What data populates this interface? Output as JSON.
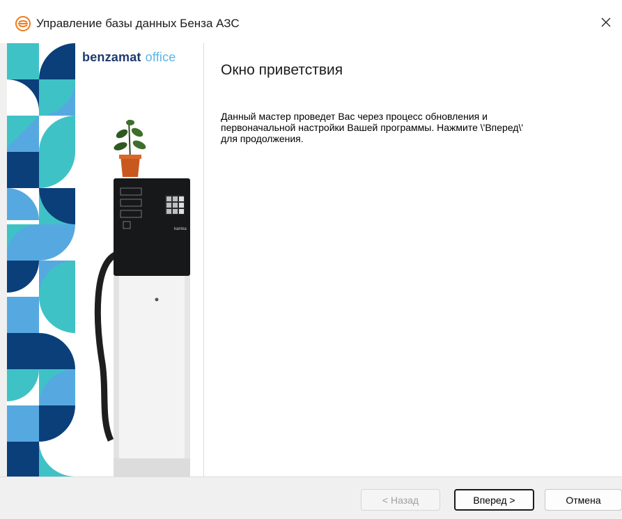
{
  "window": {
    "title": "Управление базы данных Бенза АЗС",
    "close_symbol": "✕"
  },
  "brand": {
    "part1": "benzamat",
    "part2": "office"
  },
  "pump": {
    "label": "kamka"
  },
  "content": {
    "heading": "Окно приветствия",
    "description": "Данный мастер проведет Вас через процесс обновления и\nпервоначальной настройки Вашей программы. Нажмите \\'Вперед\\'\nдля продолжения."
  },
  "buttons": {
    "back": "< Назад",
    "next": "Вперед >",
    "cancel": "Отмена"
  },
  "colors": {
    "navy": "#0b3f7a",
    "teal": "#3fc2c6",
    "light_blue": "#56a9e0",
    "brand_dark": "#1e3a6e",
    "brand_light": "#5ab6e6",
    "app_icon": "#f07a1a"
  },
  "icons": {
    "app": "benzamat-app-icon",
    "close": "close-icon"
  }
}
